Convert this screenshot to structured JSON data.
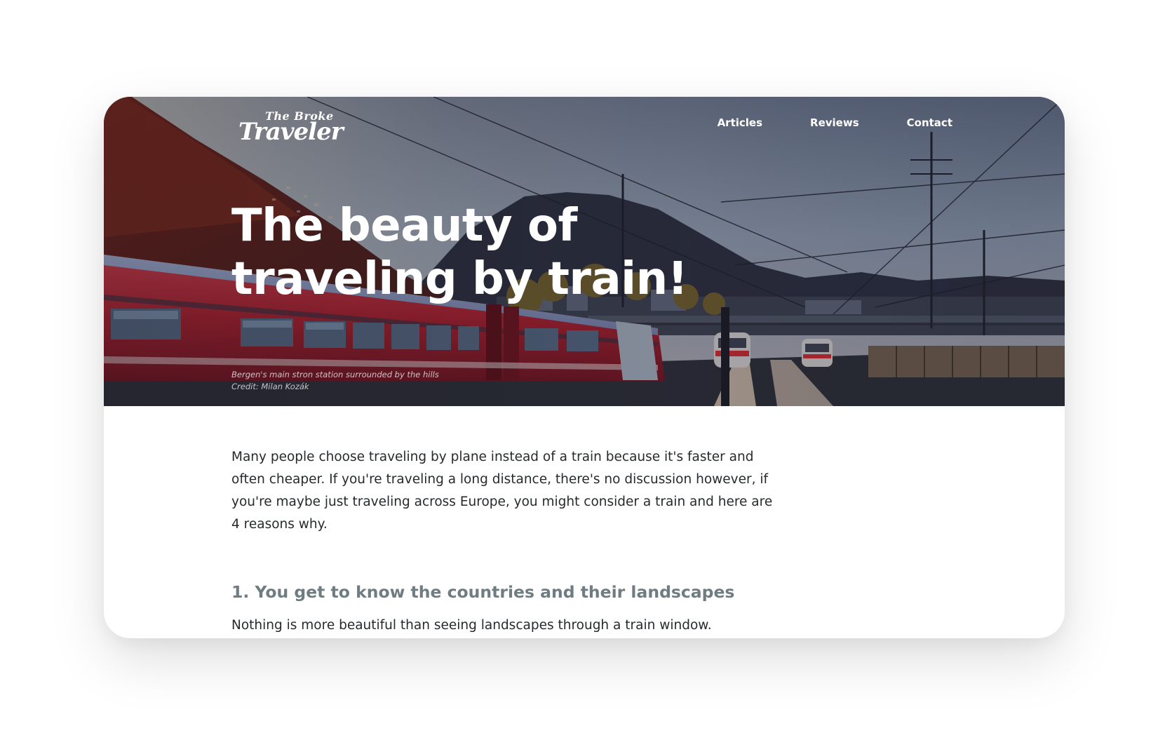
{
  "header": {
    "logo_small": "The Broke",
    "logo_big": "Traveler",
    "nav": [
      "Articles",
      "Reviews",
      "Contact"
    ]
  },
  "hero": {
    "title": "The beauty of traveling by train!",
    "caption_line1": "Bergen's main stron station surrounded by the hills",
    "caption_line2": "Credit: Milan Kozák"
  },
  "article": {
    "intro": "Many people choose traveling by plane instead of a train because it's faster and often cheaper. If you're traveling a long distance, there's no discussion however, if you're maybe just traveling across Europe, you might consider a train and here are 4 reasons why.",
    "section1_heading": "1. You get to know the countries and their landscapes",
    "section1_text": "Nothing is more beautiful than seeing landscapes through a train window. Whenever"
  },
  "colors": {
    "heading_gray": "#6f7d83",
    "body_text": "#262a2c",
    "train_red": "#b8232e"
  }
}
